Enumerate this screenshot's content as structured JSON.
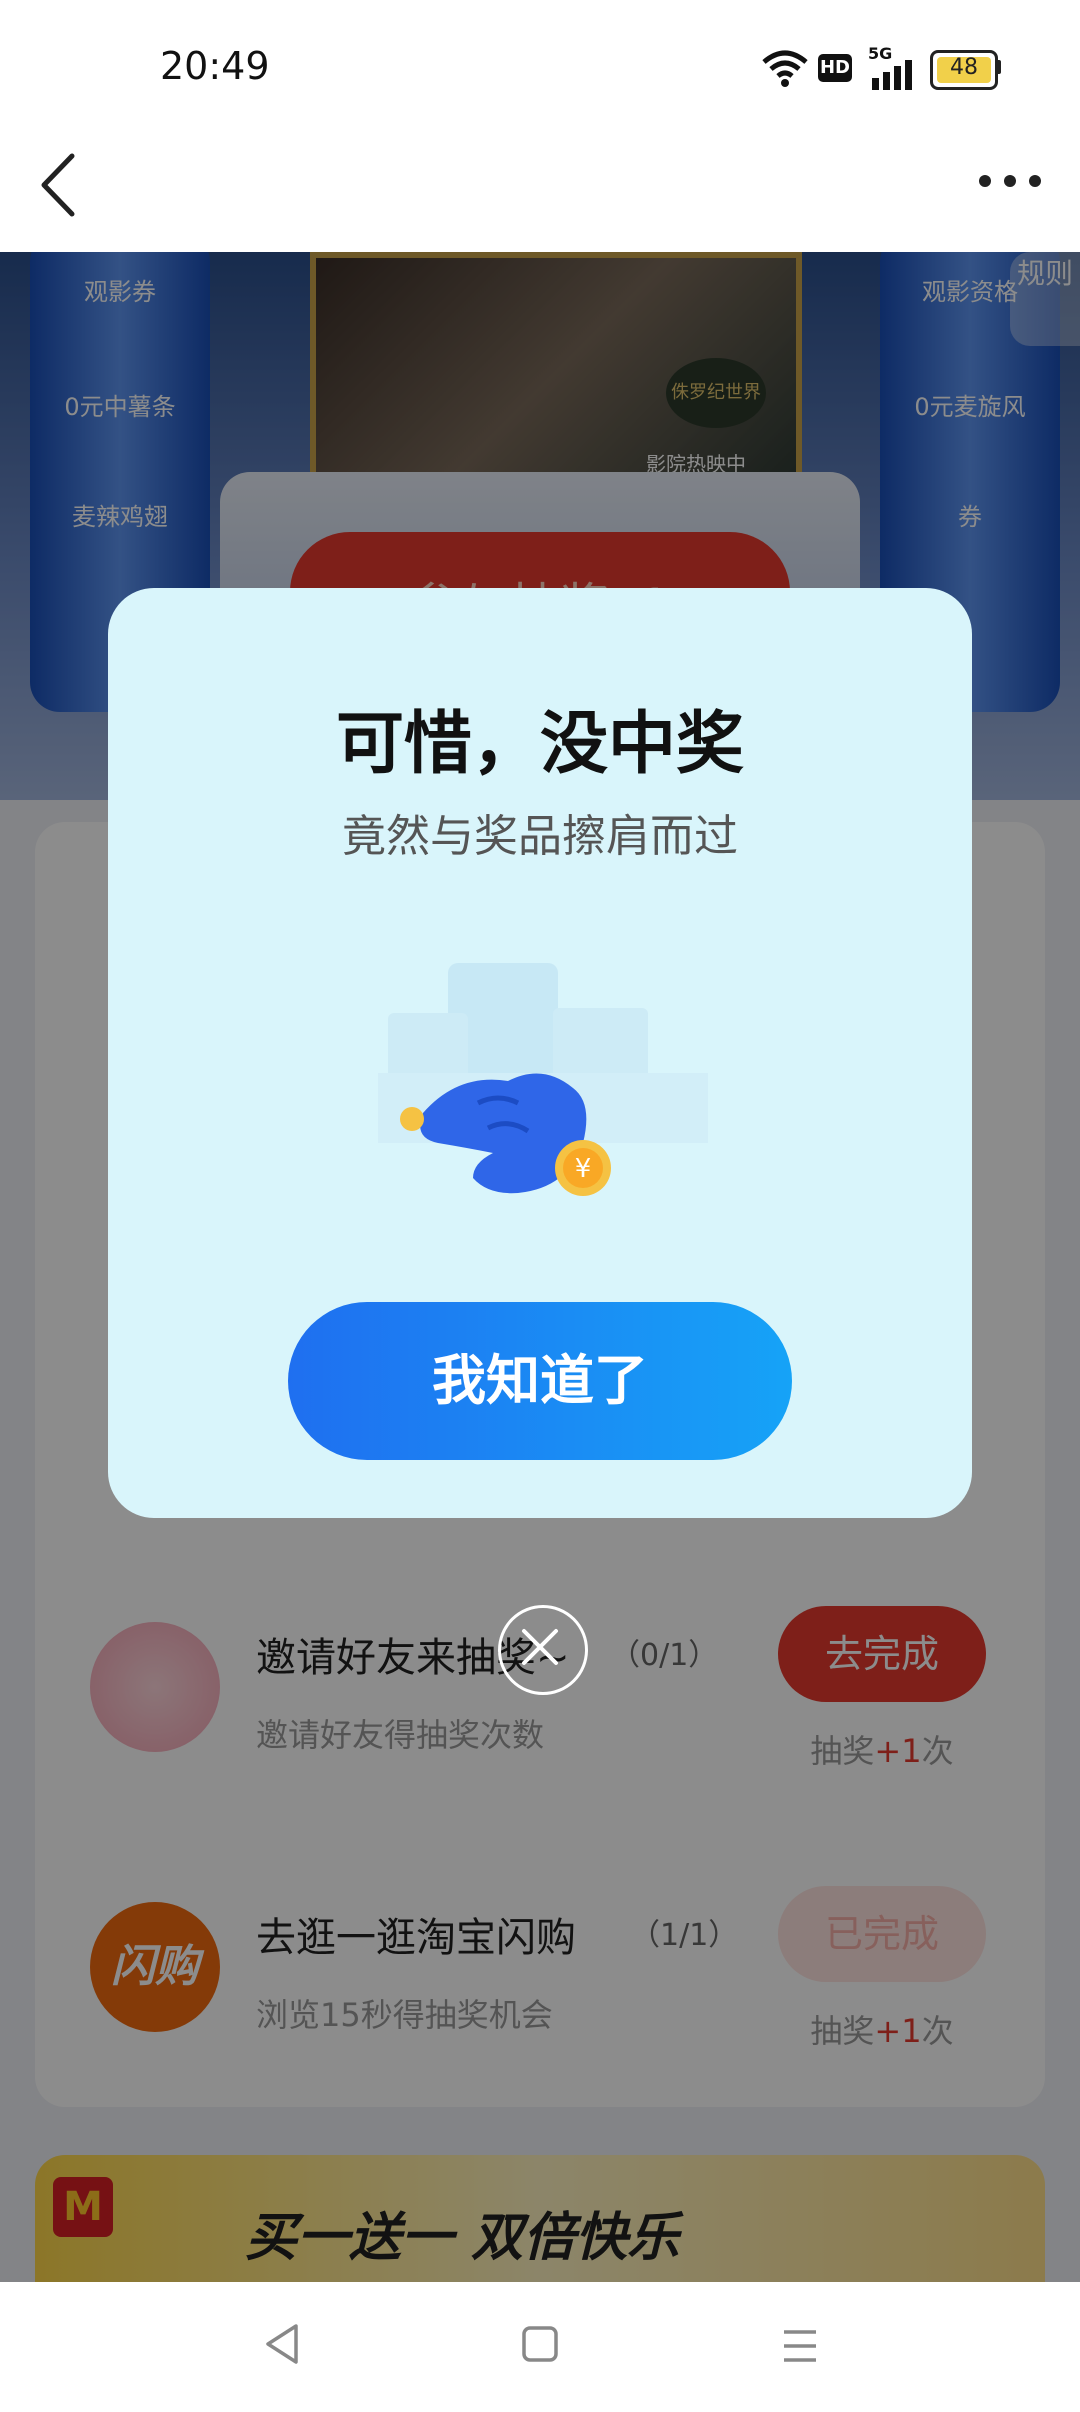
{
  "status_bar": {
    "time": "20:49",
    "network": "5G",
    "hd_label": "HD",
    "battery": "48"
  },
  "banner": {
    "left_items": [
      "观影券",
      "0元中薯条",
      "麦辣鸡翅"
    ],
    "right_items": [
      "观影资格",
      "0元麦旋风",
      "券"
    ],
    "poster_badge": "侏罗纪世界",
    "poster_sub": "影院热映中",
    "lottery_button": "参与抽奖x1",
    "rules": "规则"
  },
  "tasks": [
    {
      "title": "邀请好友来抽奖~",
      "progress": "（0/1）",
      "desc": "邀请好友得抽奖次数",
      "button": "去完成",
      "reward_prefix": "抽奖",
      "reward_plus": "+1",
      "reward_suffix": "次"
    },
    {
      "title": "去逛一逛淘宝闪购",
      "progress": "（1/1）",
      "desc": "浏览15秒得抽奖机会",
      "button": "已完成",
      "icon_text": "闪购",
      "reward_prefix": "抽奖",
      "reward_plus": "+1",
      "reward_suffix": "次"
    }
  ],
  "promo": {
    "text": "买一送一 双倍快乐"
  },
  "modal": {
    "title": "可惜，没中奖",
    "subtitle": "竟然与奖品擦肩而过",
    "button": "我知道了"
  },
  "colors": {
    "accent_red": "#e63a2e",
    "modal_bg": "#d9f5fb",
    "button_blue": "#1f6ff0"
  },
  "icons": [
    "back-icon",
    "more-icon",
    "wifi-icon",
    "signal-icon",
    "close-icon",
    "hand-coin-icon"
  ]
}
